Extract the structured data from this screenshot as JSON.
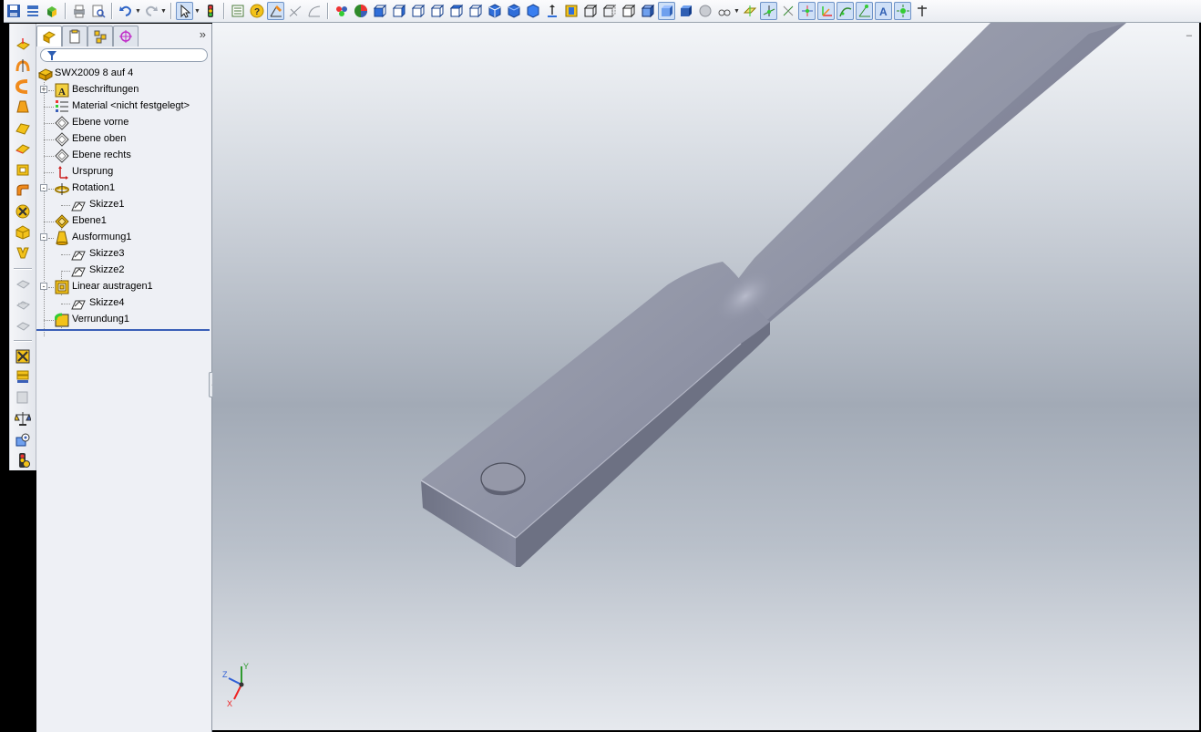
{
  "feature_manager": {
    "filter_placeholder": "",
    "tree": [
      {
        "label": "SWX2009 8 auf 4",
        "icon": "part-icon",
        "level": 0
      },
      {
        "label": "Beschriftungen",
        "icon": "annotations-icon",
        "level": 1,
        "toggle": "+"
      },
      {
        "label": "Material <nicht festgelegt>",
        "icon": "material-icon",
        "level": 1
      },
      {
        "label": "Ebene vorne",
        "icon": "plane-icon",
        "level": 1
      },
      {
        "label": "Ebene oben",
        "icon": "plane-icon",
        "level": 1
      },
      {
        "label": "Ebene rechts",
        "icon": "plane-icon",
        "level": 1
      },
      {
        "label": "Ursprung",
        "icon": "origin-icon",
        "level": 1
      },
      {
        "label": "Rotation1",
        "icon": "revolve-icon",
        "level": 1,
        "toggle": "-"
      },
      {
        "label": "Skizze1",
        "icon": "sketch-icon",
        "level": 2
      },
      {
        "label": "Ebene1",
        "icon": "plane-feature-icon",
        "level": 1
      },
      {
        "label": "Ausformung1",
        "icon": "loft-icon",
        "level": 1,
        "toggle": "-"
      },
      {
        "label": "Skizze3",
        "icon": "sketch-icon",
        "level": 2
      },
      {
        "label": "Skizze2",
        "icon": "sketch-icon",
        "level": 2
      },
      {
        "label": "Linear austragen1",
        "icon": "extrude-icon",
        "level": 1,
        "toggle": "-"
      },
      {
        "label": "Skizze4",
        "icon": "sketch-icon",
        "level": 2
      },
      {
        "label": "Verrundung1",
        "icon": "fillet-icon",
        "level": 1
      }
    ],
    "collapse_glyph": "»"
  },
  "triad": {
    "x": "X",
    "y": "Y",
    "z": "Z"
  },
  "viewport": {
    "corner_glyph": "–"
  },
  "colors": {
    "accent": "#3a5fb8",
    "model": "#8f93a3",
    "yellow_icon": "#f2c200",
    "orange_icon": "#f08a1c"
  }
}
